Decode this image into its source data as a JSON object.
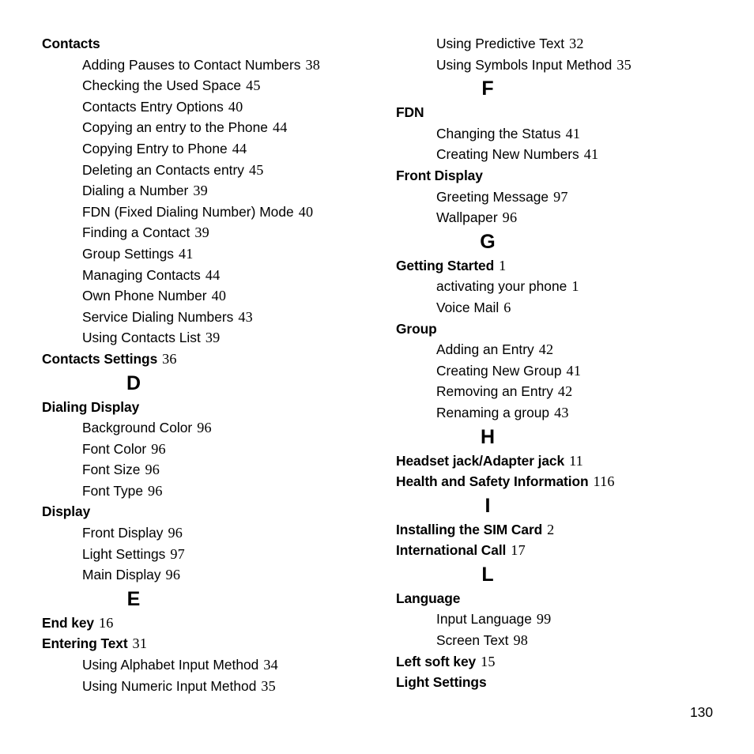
{
  "document": {
    "type": "book-index",
    "folio": "130"
  },
  "columns": [
    {
      "id": "left",
      "entries": [
        {
          "kind": "entry",
          "level": 0,
          "label": "Contacts",
          "page": ""
        },
        {
          "kind": "entry",
          "level": 1,
          "label": "Adding Pauses to Contact Numbers",
          "page": "38"
        },
        {
          "kind": "entry",
          "level": 1,
          "label": "Checking the Used Space",
          "page": "45"
        },
        {
          "kind": "entry",
          "level": 1,
          "label": "Contacts Entry Options",
          "page": "40"
        },
        {
          "kind": "entry",
          "level": 1,
          "label": "Copying an entry to the Phone",
          "page": "44"
        },
        {
          "kind": "entry",
          "level": 1,
          "label": "Copying Entry to Phone",
          "page": "44"
        },
        {
          "kind": "entry",
          "level": 1,
          "label": "Deleting an Contacts entry",
          "page": "45"
        },
        {
          "kind": "entry",
          "level": 1,
          "label": "Dialing a Number",
          "page": "39"
        },
        {
          "kind": "entry",
          "level": 1,
          "label": "FDN (Fixed Dialing Number) Mode",
          "page": "40"
        },
        {
          "kind": "entry",
          "level": 1,
          "label": "Finding a Contact",
          "page": "39"
        },
        {
          "kind": "entry",
          "level": 1,
          "label": "Group Settings",
          "page": "41"
        },
        {
          "kind": "entry",
          "level": 1,
          "label": "Managing Contacts",
          "page": "44"
        },
        {
          "kind": "entry",
          "level": 1,
          "label": "Own Phone Number",
          "page": "40"
        },
        {
          "kind": "entry",
          "level": 1,
          "label": "Service Dialing Numbers",
          "page": "43"
        },
        {
          "kind": "entry",
          "level": 1,
          "label": "Using Contacts List",
          "page": "39"
        },
        {
          "kind": "entry",
          "level": 0,
          "label": "Contacts Settings",
          "page": "36"
        },
        {
          "kind": "letter",
          "letter": "D"
        },
        {
          "kind": "entry",
          "level": 0,
          "label": "Dialing Display",
          "page": ""
        },
        {
          "kind": "entry",
          "level": 1,
          "label": "Background Color",
          "page": "96"
        },
        {
          "kind": "entry",
          "level": 1,
          "label": "Font Color",
          "page": "96"
        },
        {
          "kind": "entry",
          "level": 1,
          "label": "Font Size",
          "page": "96"
        },
        {
          "kind": "entry",
          "level": 1,
          "label": "Font Type",
          "page": "96"
        },
        {
          "kind": "entry",
          "level": 0,
          "label": "Display",
          "page": ""
        },
        {
          "kind": "entry",
          "level": 1,
          "label": "Front Display",
          "page": "96"
        },
        {
          "kind": "entry",
          "level": 1,
          "label": "Light Settings",
          "page": "97"
        },
        {
          "kind": "entry",
          "level": 1,
          "label": "Main Display",
          "page": "96"
        },
        {
          "kind": "letter",
          "letter": "E"
        },
        {
          "kind": "entry",
          "level": 0,
          "label": "End key",
          "page": "16"
        },
        {
          "kind": "entry",
          "level": 0,
          "label": "Entering Text",
          "page": "31"
        },
        {
          "kind": "entry",
          "level": 1,
          "label": "Using Alphabet Input Method",
          "page": "34"
        },
        {
          "kind": "entry",
          "level": 1,
          "label": "Using Numeric Input Method",
          "page": "35"
        }
      ]
    },
    {
      "id": "right",
      "entries": [
        {
          "kind": "entry",
          "level": 1,
          "label": "Using Predictive Text",
          "page": "32"
        },
        {
          "kind": "entry",
          "level": 1,
          "label": "Using Symbols Input Method",
          "page": "35"
        },
        {
          "kind": "letter",
          "letter": "F"
        },
        {
          "kind": "entry",
          "level": 0,
          "label": "FDN",
          "page": ""
        },
        {
          "kind": "entry",
          "level": 1,
          "label": "Changing the Status",
          "page": "41"
        },
        {
          "kind": "entry",
          "level": 1,
          "label": "Creating New Numbers",
          "page": "41"
        },
        {
          "kind": "entry",
          "level": 0,
          "label": "Front Display",
          "page": ""
        },
        {
          "kind": "entry",
          "level": 1,
          "label": "Greeting Message",
          "page": "97"
        },
        {
          "kind": "entry",
          "level": 1,
          "label": "Wallpaper",
          "page": "96"
        },
        {
          "kind": "letter",
          "letter": "G"
        },
        {
          "kind": "entry",
          "level": 0,
          "label": "Getting Started",
          "page": "1"
        },
        {
          "kind": "entry",
          "level": 1,
          "label": "activating your phone",
          "page": "1"
        },
        {
          "kind": "entry",
          "level": 1,
          "label": "Voice Mail",
          "page": "6"
        },
        {
          "kind": "entry",
          "level": 0,
          "label": "Group",
          "page": ""
        },
        {
          "kind": "entry",
          "level": 1,
          "label": "Adding an Entry",
          "page": "42"
        },
        {
          "kind": "entry",
          "level": 1,
          "label": "Creating New Group",
          "page": "41"
        },
        {
          "kind": "entry",
          "level": 1,
          "label": "Removing an Entry",
          "page": "42"
        },
        {
          "kind": "entry",
          "level": 1,
          "label": "Renaming a group",
          "page": "43"
        },
        {
          "kind": "letter",
          "letter": "H"
        },
        {
          "kind": "entry",
          "level": 0,
          "label": "Headset jack/Adapter jack",
          "page": "11"
        },
        {
          "kind": "entry",
          "level": 0,
          "label": "Health and Safety Information",
          "page": "116"
        },
        {
          "kind": "letter",
          "letter": "I"
        },
        {
          "kind": "entry",
          "level": 0,
          "label": "Installing the SIM Card",
          "page": "2"
        },
        {
          "kind": "entry",
          "level": 0,
          "label": "International Call",
          "page": "17"
        },
        {
          "kind": "letter",
          "letter": "L"
        },
        {
          "kind": "entry",
          "level": 0,
          "label": "Language",
          "page": ""
        },
        {
          "kind": "entry",
          "level": 1,
          "label": "Input Language",
          "page": "99"
        },
        {
          "kind": "entry",
          "level": 1,
          "label": "Screen Text",
          "page": "98"
        },
        {
          "kind": "entry",
          "level": 0,
          "label": "Left soft key",
          "page": "15"
        },
        {
          "kind": "entry",
          "level": 0,
          "label": "Light Settings",
          "page": ""
        }
      ]
    }
  ]
}
